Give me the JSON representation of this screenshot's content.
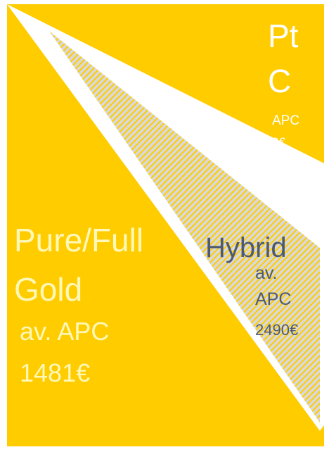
{
  "colors": {
    "gold": "#FFCC00",
    "hatch_bg": "#D9D9D9",
    "hybrid_text": "#4D5A73",
    "gold_text": "#FFF8B8"
  },
  "platinum": {
    "title_line1": "Pt",
    "title_line2": "C",
    "apc_label": "APC",
    "apc_value": "0€"
  },
  "gold": {
    "title_line1": "Pure/Full",
    "title_line2": "Gold",
    "apc_label": "av. APC",
    "apc_value": "1481€"
  },
  "hybrid": {
    "title": "Hybrid",
    "apc_label_line1": "av.",
    "apc_label_line2": "APC",
    "apc_value": "2490€"
  }
}
